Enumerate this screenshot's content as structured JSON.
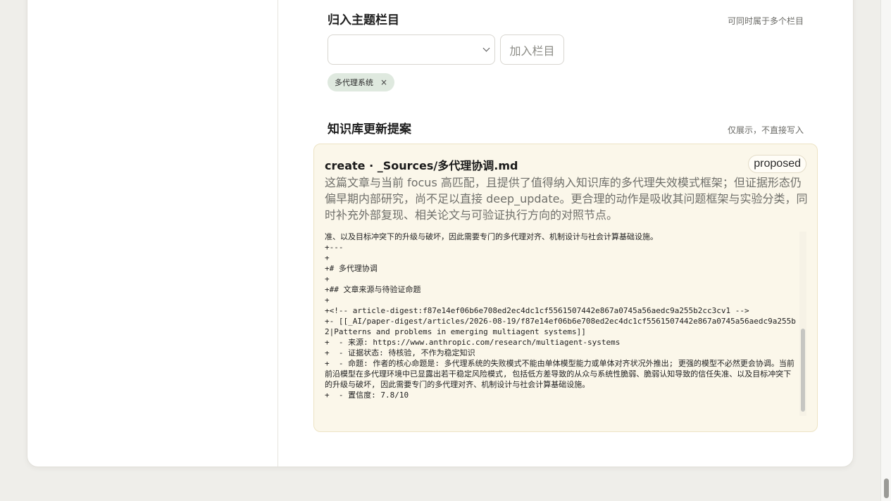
{
  "topics": {
    "title": "归入主题栏目",
    "note": "可同时属于多个栏目",
    "select_value": "",
    "add_button": "加入栏目",
    "tags": [
      {
        "label": "多代理系统",
        "remove": "×"
      }
    ]
  },
  "kb": {
    "title": "知识库更新提案",
    "note": "仅展示，不直接写入"
  },
  "proposal": {
    "title": "create · _Sources/多代理协调.md",
    "status": "proposed",
    "summary": "这篇文章与当前 focus 高匹配，且提供了值得纳入知识库的多代理失效模式框架；但证据形态仍偏早期内部研究，尚不足以直接 deep_update。更合理的动作是吸收其问题框架与实验分类，同时补充外部复现、相关论文与可验证执行方向的对照节点。",
    "diff": "准、以及目标冲突下的升级与破坏，因此需要专门的多代理对齐、机制设计与社会计算基础设施。\n+---\n+\n+# 多代理协调\n+\n+## 文章来源与待验证命题\n+\n+<!-- article-digest:f87e14ef06b6e708ed2ec4dc1cf5561507442e867a0745a56aedc9a255b2cc3cv1 -->\n+- [[_AI/paper-digest/articles/2026-08-19/f87e14ef06b6e708ed2ec4dc1cf5561507442e867a0745a56aedc9a255b2|Patterns and problems in emerging multiagent systems]]\n+  - 来源: https://www.anthropic.com/research/multiagent-systems\n+  - 证据状态: 待核验, 不作为稳定知识\n+  - 命题: 作者的核心命题是: 多代理系统的失败模式不能由单体模型能力或单体对齐状况外推出; 更强的模型不必然更会协调。当前前沿模型在多代理环境中已显露出若干稳定风险模式, 包括低方差导致的从众与系统性脆弱、脆弱认知导致的信任失准、以及目标冲突下的升级与破坏, 因此需要专门的多代理对齐、机制设计与社会计算基础设施。\n+  - 置信度: 7.8/10"
  }
}
